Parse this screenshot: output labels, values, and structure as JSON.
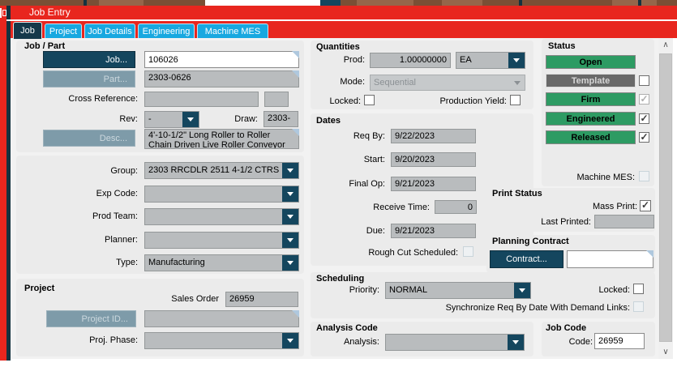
{
  "window": {
    "title": "Job Entry"
  },
  "tabs": [
    {
      "label": "Job"
    },
    {
      "label": "Project"
    },
    {
      "label": "Job Details"
    },
    {
      "label": "Engineering"
    },
    {
      "label": "Machine MES"
    }
  ],
  "job_part": {
    "section_title": "Job / Part",
    "job_button": "Job...",
    "job_value": "106026",
    "part_button": "Part...",
    "part_value": "2303-0626",
    "cross_reference_label": "Cross Reference:",
    "cross_reference_value": "",
    "rev_label": "Rev:",
    "rev_value": "-",
    "draw_label": "Draw:",
    "draw_value": "2303-",
    "desc_button": "Desc...",
    "desc_value": "4'-10-1/2\" Long Roller to Roller Chain Driven Live Roller Conveyor"
  },
  "classification": {
    "group_label": "Group:",
    "group_value": "2303 RRCDLR 2511 4-1/2 CTRS",
    "exp_code_label": "Exp Code:",
    "exp_code_value": "",
    "prod_team_label": "Prod Team:",
    "prod_team_value": "",
    "planner_label": "Planner:",
    "planner_value": "",
    "type_label": "Type:",
    "type_value": "Manufacturing"
  },
  "project": {
    "section_title": "Project",
    "sales_order_label": "Sales Order",
    "sales_order_value": "26959",
    "project_id_button": "Project ID...",
    "project_id_value": "",
    "proj_phase_label": "Proj. Phase:",
    "proj_phase_value": ""
  },
  "quantities": {
    "section_title": "Quantities",
    "prod_label": "Prod:",
    "prod_value": "1.00000000",
    "uom_value": "EA",
    "mode_label": "Mode:",
    "mode_value": "Sequential",
    "locked_label": "Locked:",
    "locked_state": "unchecked",
    "production_yield_label": "Production Yield:",
    "production_yield_state": "unchecked"
  },
  "dates": {
    "section_title": "Dates",
    "req_by_label": "Req By:",
    "req_by_value": "9/22/2023",
    "start_label": "Start:",
    "start_value": "9/20/2023",
    "final_op_label": "Final Op:",
    "final_op_value": "9/21/2023",
    "receive_time_label": "Receive Time:",
    "receive_time_value": "0",
    "due_label": "Due:",
    "due_value": "9/21/2023",
    "rough_cut_label": "Rough Cut Scheduled:",
    "rough_cut_state": "disabled"
  },
  "scheduling": {
    "section_title": "Scheduling",
    "priority_label": "Priority:",
    "priority_value": "NORMAL",
    "locked_label": "Locked:",
    "locked_state": "unchecked",
    "synchronize_label": "Synchronize Req By Date With Demand Links:",
    "synchronize_state": "disabled"
  },
  "analysis_code": {
    "section_title": "Analysis Code",
    "analysis_label": "Analysis:",
    "analysis_value": ""
  },
  "job_code": {
    "section_title": "Job Code",
    "code_label": "Code:",
    "code_value": "26959"
  },
  "status": {
    "section_title": "Status",
    "buttons": [
      {
        "label": "Open",
        "style": "green",
        "checkbox": "none"
      },
      {
        "label": "Template",
        "style": "dark",
        "checkbox": "unchecked"
      },
      {
        "label": "Firm",
        "style": "green",
        "checkbox": "checked-disabled"
      },
      {
        "label": "Engineered",
        "style": "green",
        "checkbox": "checked"
      },
      {
        "label": "Released",
        "style": "green",
        "checkbox": "checked"
      }
    ],
    "machine_mes_label": "Machine MES:",
    "machine_mes_state": "disabled"
  },
  "print_status": {
    "section_title": "Print Status",
    "mass_print_label": "Mass Print:",
    "mass_print_state": "checked",
    "last_printed_label": "Last Printed:",
    "last_printed_value": ""
  },
  "planning_contract": {
    "section_title": "Planning Contract",
    "contract_button": "Contract...",
    "contract_value": ""
  },
  "colors": {
    "titlebar_red": "#e8261e",
    "tab_cyan": "#18a8e0",
    "tab_active_navy": "#15384a",
    "button_navy": "#14465e",
    "status_green": "#2d9b63",
    "readonly_field_gray": "#b9bcbe"
  }
}
